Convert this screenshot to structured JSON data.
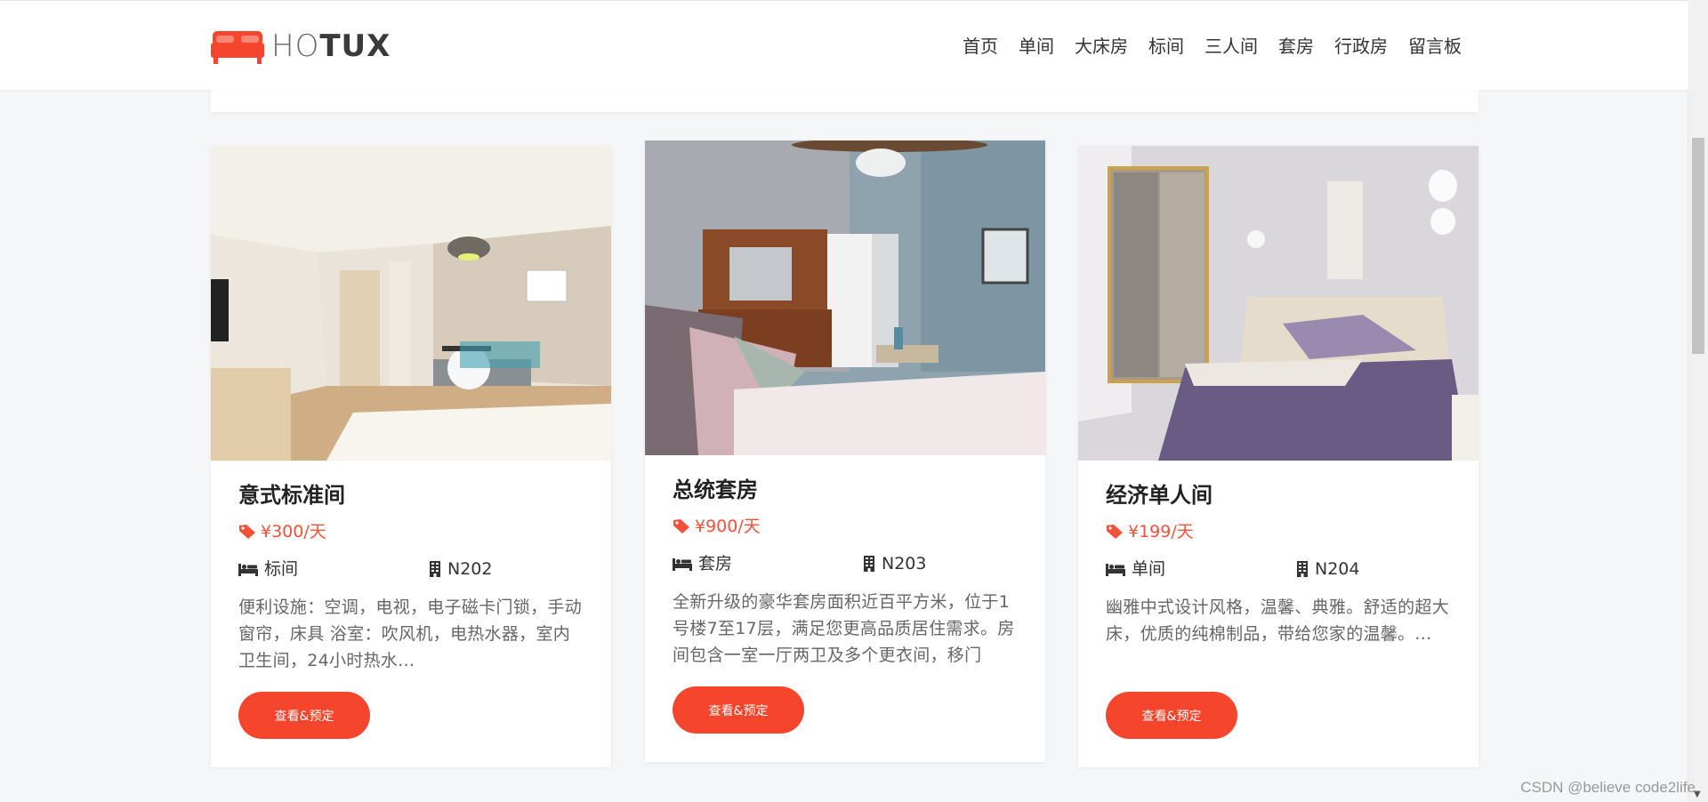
{
  "brand": {
    "logo_text_thin": "HO",
    "logo_text_bold": "TUX",
    "accent": "#f5452c"
  },
  "nav": {
    "items": [
      "首页",
      "单间",
      "大床房",
      "标间",
      "三人间",
      "套房",
      "行政房",
      "留言板"
    ]
  },
  "rooms": [
    {
      "title": "意式标准间",
      "price": "¥300/天",
      "type": "标间",
      "room_no": "N202",
      "desc": "便利设施：空调，电视，电子磁卡门锁，手动窗帘，床具 浴室：吹风机，电热水器，室内卫生间，24小时热水...",
      "button": "查看&预定"
    },
    {
      "title": "总统套房",
      "price": "¥900/天",
      "type": "套房",
      "room_no": "N203",
      "desc": "全新升级的豪华套房面积近百平方米，位于1号楼7至17层，满足您更高品质居住需求。房间包含一室一厅两卫及多个更衣间，移门",
      "button": "查看&预定"
    },
    {
      "title": "经济单人间",
      "price": "¥199/天",
      "type": "单间",
      "room_no": "N204",
      "desc": "幽雅中式设计风格，温馨、典雅。舒适的超大床，优质的纯棉制品，带给您家的温馨。...",
      "button": "查看&预定"
    }
  ],
  "icons": {
    "price": "tag-icon",
    "type": "bed-icon",
    "room_no": "building-icon"
  },
  "watermark": "CSDN @believe code2life"
}
